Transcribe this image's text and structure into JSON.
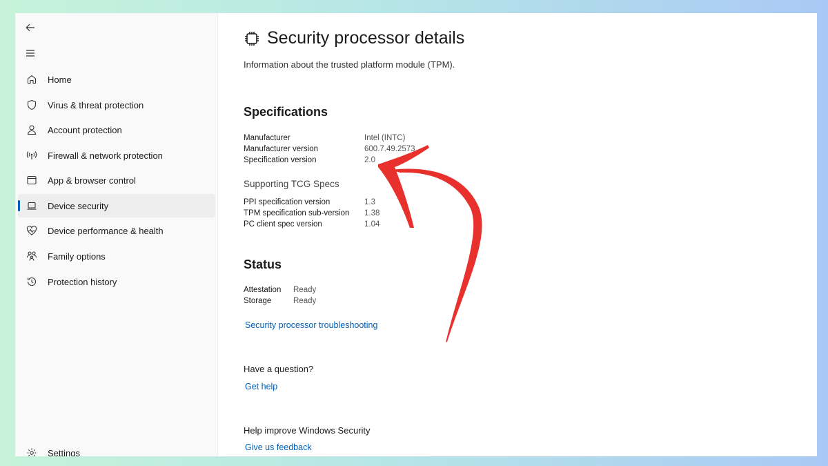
{
  "sidebar": {
    "back_icon": "back-arrow-icon",
    "menu_icon": "hamburger-menu-icon",
    "items": [
      {
        "label": "Home",
        "icon": "home-icon"
      },
      {
        "label": "Virus & threat protection",
        "icon": "shield-icon"
      },
      {
        "label": "Account protection",
        "icon": "person-icon"
      },
      {
        "label": "Firewall & network protection",
        "icon": "wireless-antenna-icon"
      },
      {
        "label": "App & browser control",
        "icon": "app-window-icon"
      },
      {
        "label": "Device security",
        "icon": "laptop-icon",
        "active": true
      },
      {
        "label": "Device performance & health",
        "icon": "heart-pulse-icon"
      },
      {
        "label": "Family options",
        "icon": "family-icon"
      },
      {
        "label": "Protection history",
        "icon": "history-clock-icon"
      }
    ],
    "settings_label": "Settings",
    "settings_icon": "gear-icon"
  },
  "main": {
    "title": "Security processor details",
    "title_icon": "chip-icon",
    "subtitle": "Information about the trusted platform module (TPM).",
    "specifications": {
      "heading": "Specifications",
      "rows": [
        {
          "key": "Manufacturer",
          "value": "Intel (INTC)"
        },
        {
          "key": "Manufacturer version",
          "value": "600.7.49.2573"
        },
        {
          "key": "Specification version",
          "value": "2.0"
        }
      ]
    },
    "tcg": {
      "heading": "Supporting TCG Specs",
      "rows": [
        {
          "key": "PPI specification version",
          "value": "1.3"
        },
        {
          "key": "TPM specification sub-version",
          "value": "1.38"
        },
        {
          "key": "PC client spec version",
          "value": "1.04"
        }
      ]
    },
    "status": {
      "heading": "Status",
      "rows": [
        {
          "key": "Attestation",
          "value": "Ready"
        },
        {
          "key": "Storage",
          "value": "Ready"
        }
      ]
    },
    "troubleshoot_link": "Security processor troubleshooting",
    "question_heading": "Have a question?",
    "get_help_link": "Get help",
    "improve_heading": "Help improve Windows Security",
    "feedback_link": "Give us feedback"
  },
  "annotation": {
    "color": "#e8302c",
    "icon": "hand-drawn-arrow"
  }
}
